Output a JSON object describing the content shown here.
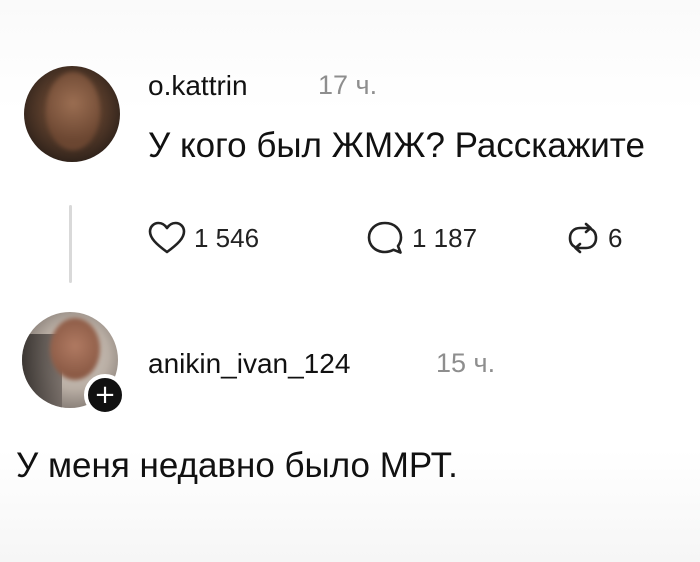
{
  "posts": [
    {
      "username": "o.kattrin",
      "time": "17 ч.",
      "text": "У кого был ЖМЖ? Расскажите",
      "likes": "1 546",
      "comments": "1 187",
      "reposts": "6"
    },
    {
      "username": "anikin_ivan_124",
      "time": "15 ч.",
      "text": "У меня недавно было МРТ."
    }
  ],
  "icons": {
    "like": "heart-icon",
    "comment": "speech-bubble-icon",
    "repost": "repost-icon",
    "follow": "plus-icon"
  },
  "colors": {
    "text": "#111111",
    "muted": "#8e8e8e",
    "thread_line": "#d9d9d9",
    "badge": "#111111"
  }
}
